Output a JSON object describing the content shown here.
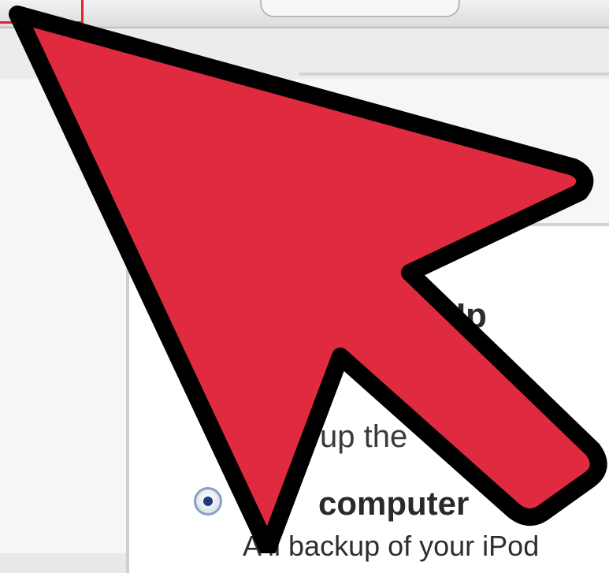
{
  "section": {
    "heading": "ck Up",
    "prompt": "up the"
  },
  "backup_option": {
    "label": "computer",
    "description": "A   ll backup of your iPod",
    "selected": true
  },
  "overlay": {
    "pointer_fill": "#e02a3f",
    "pointer_stroke": "#000000",
    "highlight_color": "#e0222f"
  }
}
